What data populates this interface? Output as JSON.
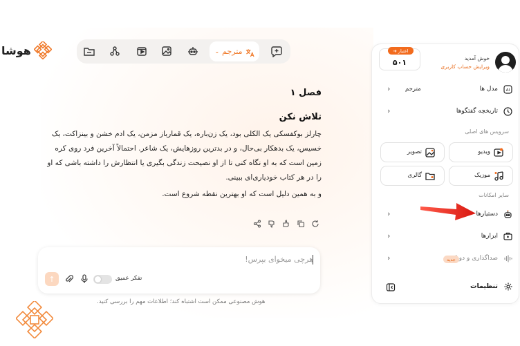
{
  "brand": {
    "name": "هوشا",
    "accent": "#f26b1d"
  },
  "toolbar": {
    "translator_label": "مترجم",
    "icons": [
      "chat-plus-icon",
      "translate-icon",
      "robot-icon",
      "image-icon",
      "video-icon",
      "nodes-icon",
      "folder-icon"
    ]
  },
  "chat": {
    "chapter": "فصل ۱",
    "subtitle": "تلاش نکن",
    "paragraph": "چارلز بوکفسکی یک الکلی بود، یک زن‌باره، یک قمارباز مزمن، یک ادم خشن و بینزاکت، یک خسیس، یک بدهکار بی‌حال، و در بدترین روزهایش، یک شاعر. احتمالاً آخرین فرد روی کره زمین است که به او نگاه کنی تا از او نصیحت زندگی بگیری یا انتظارش را داشته باشی که او را در هر کتاب خودیاری‌ای ببینی.",
    "closing": "و به همین دلیل است که او بهترین نقطه شروع است."
  },
  "input": {
    "placeholder": "هرچی میخوای بپرس!",
    "deep_thinking_label": "تفکر عمیق",
    "send_icon": "↑",
    "disclaimer": "هوش مصنوعی ممکن است اشتباه کند؛ اطلاعات مهم را بررسی کنید."
  },
  "sidebar": {
    "welcome": "خوش آمدید",
    "edit_profile": "ویرایش حساب کاربری",
    "credit_badge": "اعتبار",
    "credit_value": "۵۰۱",
    "models_label": "مدل ها",
    "models_value": "مترجم",
    "history_label": "تاریخچه گفتگوها",
    "main_services_title": "سرویس های اصلی",
    "services": {
      "video": "ویدیو",
      "image": "تصویر",
      "music": "موزیک",
      "gallery": "گالری"
    },
    "other_features_title": "سایر امکانات",
    "assistants_label": "دستیارها",
    "tools_label": "ابزارها",
    "dubbing_label": "صداگذاری و دوبله",
    "new_badge": "جدید",
    "settings_label": "تنظیمات"
  },
  "colors": {
    "annotation_arrow": "#e8241c",
    "accent": "#f26b1d"
  }
}
